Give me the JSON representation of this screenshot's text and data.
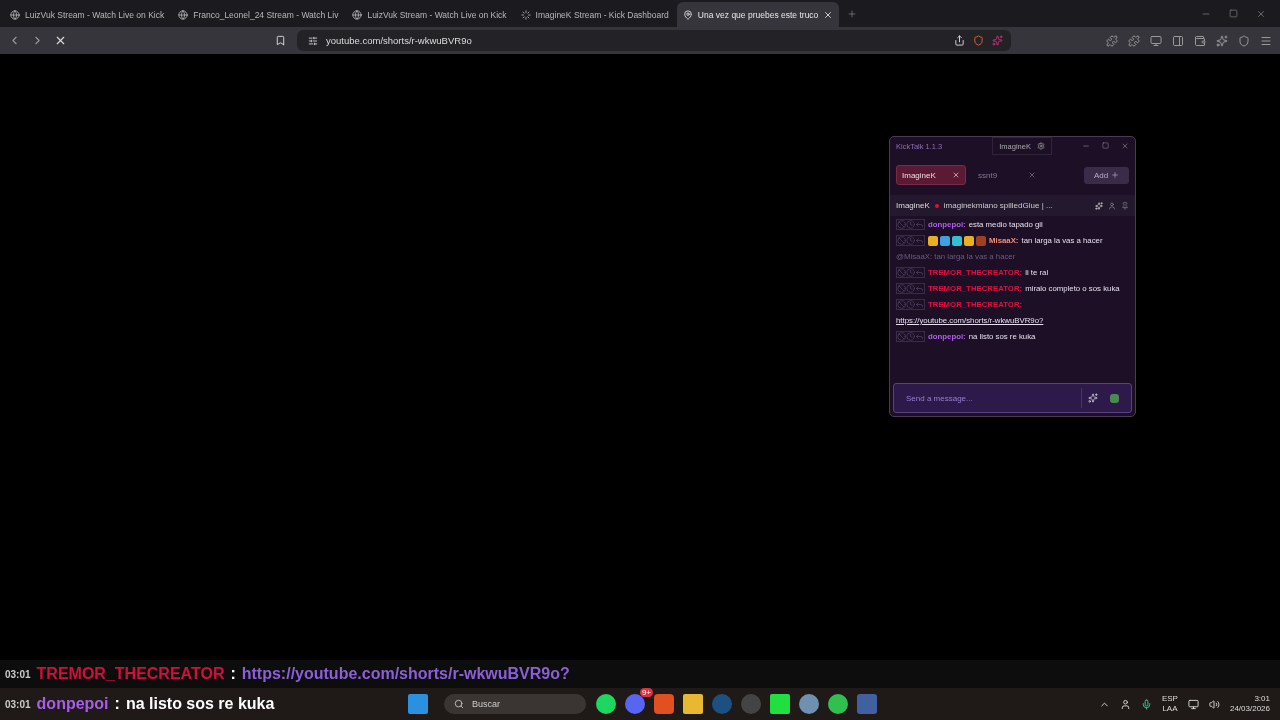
{
  "browser": {
    "tabs": [
      {
        "title": "LuizVuk Stream - Watch Live on Kick",
        "selected": false,
        "loading": false
      },
      {
        "title": "Franco_Leonel_24 Stream - Watch Liv",
        "selected": false,
        "loading": false
      },
      {
        "title": "LuizVuk Stream - Watch Live on Kick",
        "selected": false,
        "loading": false
      },
      {
        "title": "ImagineK Stream - Kick Dashboard",
        "selected": false,
        "loading": true
      },
      {
        "title": "Una vez que pruebes este truco",
        "selected": true,
        "loading": false
      }
    ],
    "address": "youtube.com/shorts/r-wkwuBVR9o"
  },
  "kicktalk": {
    "title": "KickTalk 1.1.3",
    "account": "ImagineK",
    "chat_tabs": [
      {
        "label": "ImagineK",
        "selected": true
      },
      {
        "label": "ssnt9",
        "selected": false
      }
    ],
    "add_button": "Add",
    "channel": "ImagineK",
    "stream_title": "imaginekmiano spilledGlue | ...",
    "messages": [
      {
        "kind": "text",
        "user": "donpepoi:",
        "color": "#b35cf0",
        "text": "esta medio tapado gil",
        "badges": false
      },
      {
        "kind": "text",
        "user": "MisaaX:",
        "color": "#f0907a",
        "text": "tan larga la vas a hacer",
        "badges": true
      },
      {
        "kind": "reply",
        "text": "@MisaaX: tan larga la vas a hacer"
      },
      {
        "kind": "text",
        "user": "TREMOR_THECREATOR:",
        "color": "#e0103c",
        "text": "li te ral",
        "badges": false
      },
      {
        "kind": "text",
        "user": "TREMOR_THECREATOR:",
        "color": "#e0103c",
        "text": "miralo completo o sos kuka",
        "badges": false
      },
      {
        "kind": "link",
        "user": "TREMOR_THECREATOR:",
        "color": "#e0103c",
        "text": "https://youtube.com/shorts/r-wkwuBVR9o?",
        "badges": false
      },
      {
        "kind": "text",
        "user": "donpepoi:",
        "color": "#b35cf0",
        "text": "na listo sos re kuka",
        "badges": false
      }
    ],
    "input": {
      "placeholder": "Send a message..."
    }
  },
  "overlay": [
    {
      "time": "03:01",
      "user": "TREMOR_THECREATOR",
      "color": "#d0103a",
      "separator": ":",
      "text": "https://youtube.com/shorts/r-wkwuBVR9o?",
      "kind": "link"
    },
    {
      "time": "03:01",
      "user": "donpepoi",
      "color": "#a85ee8",
      "separator": ":",
      "text": "na listo sos re kuka",
      "kind": "text"
    }
  ],
  "taskbar": {
    "search": {
      "placeholder": "Buscar"
    },
    "discord_badge": "9+",
    "language": "ESP",
    "region": "LAA",
    "time": "3:01",
    "date": "24/03/2026"
  }
}
